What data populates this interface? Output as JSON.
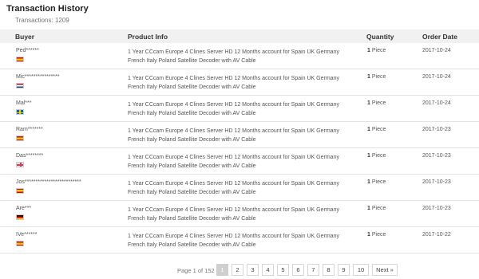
{
  "header": {
    "title": "Transaction History",
    "count_label": "Transactions: 1209"
  },
  "table": {
    "columns": {
      "buyer": "Buyer",
      "product": "Product Info",
      "quantity": "Quantity",
      "date": "Order Date"
    },
    "rows": [
      {
        "buyer": "Ped******",
        "flag": "spain-flag-icon",
        "product_line1": "1 Year CCcam Europe 4 Clines Server HD 12 Months account for Spain UK Germany",
        "product_line2": "French Italy Poland Satellite Decoder with AV Cable",
        "qty_num": "1",
        "qty_unit": "Piece",
        "date": "2017-10-24"
      },
      {
        "buyer": "Mic****************",
        "flag": "netherlands-flag-icon",
        "product_line1": "1 Year CCcam Europe 4 Clines Server HD 12 Months account for Spain UK Germany",
        "product_line2": "French Italy Poland Satellite Decoder with AV Cable",
        "qty_num": "1",
        "qty_unit": "Piece",
        "date": "2017-10-24"
      },
      {
        "buyer": "Mal***",
        "flag": "sweden-flag-icon",
        "product_line1": "1 Year CCcam Europe 4 Clines Server HD 12 Months account for Spain UK Germany",
        "product_line2": "French Italy Poland Satellite Decoder with AV Cable",
        "qty_num": "1",
        "qty_unit": "Piece",
        "date": "2017-10-24"
      },
      {
        "buyer": "Ram*******",
        "flag": "spain-flag-icon",
        "product_line1": "1 Year CCcam Europe 4 Clines Server HD 12 Months account for Spain UK Germany",
        "product_line2": "French Italy Poland Satellite Decoder with AV Cable",
        "qty_num": "1",
        "qty_unit": "Piece",
        "date": "2017-10-23"
      },
      {
        "buyer": "Das********",
        "flag": "uk-flag-icon",
        "product_line1": "1 Year CCcam Europe 4 Clines Server HD 12 Months account for Spain UK Germany",
        "product_line2": "French Italy Poland Satellite Decoder with AV Cable",
        "qty_num": "1",
        "qty_unit": "Piece",
        "date": "2017-10-23"
      },
      {
        "buyer": "Jos**************************",
        "flag": "spain-flag-icon",
        "product_line1": "1 Year CCcam Europe 4 Clines Server HD 12 Months account for Spain UK Germany",
        "product_line2": "French Italy Poland Satellite Decoder with AV Cable",
        "qty_num": "1",
        "qty_unit": "Piece",
        "date": "2017-10-23"
      },
      {
        "buyer": "Are***",
        "flag": "germany-flag-icon",
        "product_line1": "1 Year CCcam Europe 4 Clines Server HD 12 Months account for Spain UK Germany",
        "product_line2": "French Italy Poland Satellite Decoder with AV Cable",
        "qty_num": "1",
        "qty_unit": "Piece",
        "date": "2017-10-23"
      },
      {
        "buyer": "IVe******",
        "flag": "spain-flag-icon",
        "product_line1": "1 Year CCcam Europe 4 Clines Server HD 12 Months account for Spain UK Germany",
        "product_line2": "French Italy Poland Satellite Decoder with AV Cable",
        "qty_num": "1",
        "qty_unit": "Piece",
        "date": "2017-10-22"
      }
    ]
  },
  "pagination": {
    "label": "Page 1 of 152",
    "pages": [
      "1",
      "2",
      "3",
      "4",
      "5",
      "6",
      "7",
      "8",
      "9",
      "10"
    ],
    "current": "1",
    "next_label": "Next »"
  }
}
